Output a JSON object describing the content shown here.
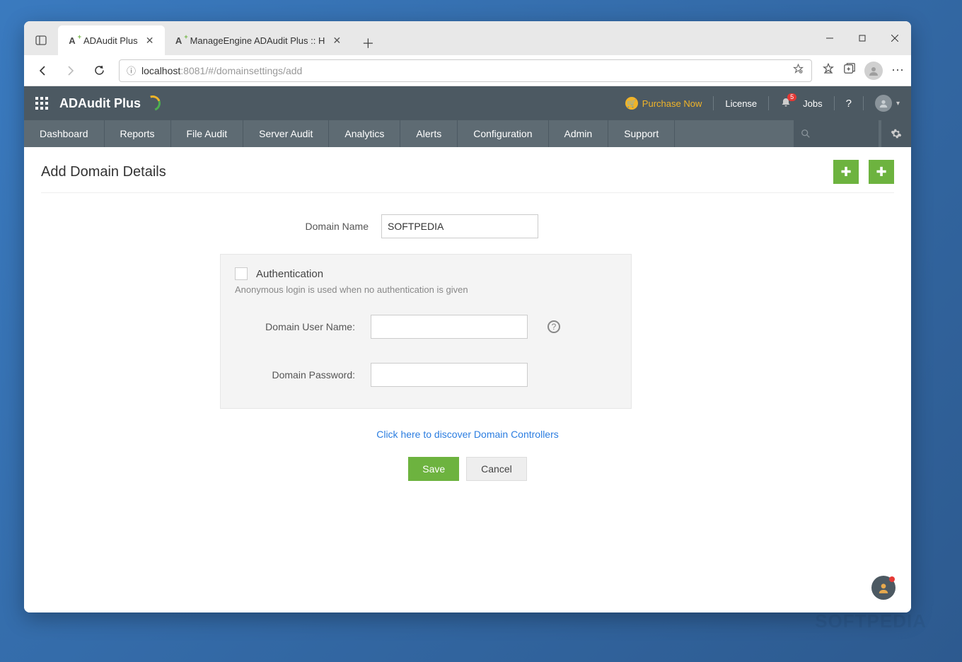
{
  "browser": {
    "tabs": [
      {
        "title": "ADAudit Plus",
        "active": true
      },
      {
        "title": "ManageEngine ADAudit Plus :: H",
        "active": false
      }
    ],
    "url_host": "localhost",
    "url_port": ":8081",
    "url_path": "/#/domainsettings/add"
  },
  "header": {
    "brand": "ADAudit Plus",
    "purchase": "Purchase Now",
    "license": "License",
    "jobs": "Jobs",
    "bell_badge": "5"
  },
  "nav": {
    "items": [
      "Dashboard",
      "Reports",
      "File Audit",
      "Server Audit",
      "Analytics",
      "Alerts",
      "Configuration",
      "Admin",
      "Support"
    ]
  },
  "page": {
    "title": "Add Domain Details",
    "domain_name_label": "Domain Name",
    "domain_name_value": "SOFTPEDIA",
    "auth_label": "Authentication",
    "auth_hint": "Anonymous login is used when no authentication is given",
    "user_label": "Domain User Name:",
    "pass_label": "Domain Password:",
    "discover_link": "Click here to discover Domain Controllers",
    "save": "Save",
    "cancel": "Cancel"
  },
  "watermark": "SOFTPEDIA"
}
